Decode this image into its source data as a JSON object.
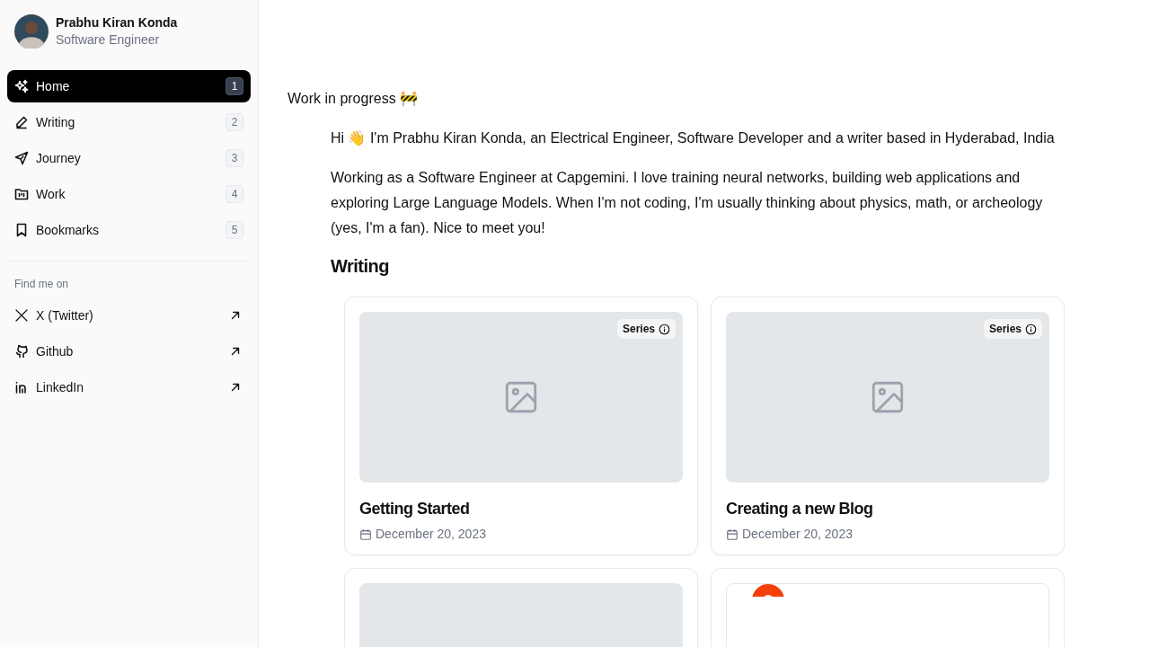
{
  "profile": {
    "name": "Prabhu Kiran Konda",
    "role": "Software Engineer"
  },
  "nav": [
    {
      "label": "Home",
      "shortcut": "1",
      "selected": true
    },
    {
      "label": "Writing",
      "shortcut": "2",
      "selected": false
    },
    {
      "label": "Journey",
      "shortcut": "3",
      "selected": false
    },
    {
      "label": "Work",
      "shortcut": "4",
      "selected": false
    },
    {
      "label": "Bookmarks",
      "shortcut": "5",
      "selected": false
    }
  ],
  "social": {
    "heading": "Find me on",
    "links": [
      {
        "label": "X (Twitter)"
      },
      {
        "label": "Github"
      },
      {
        "label": "LinkedIn"
      }
    ]
  },
  "banner": "Work in progress 🚧",
  "intro": [
    "Hi 👋 I'm Prabhu Kiran Konda, an Electrical Engineer, Software Developer and a writer based in Hyderabad, India",
    "Working as a Software Engineer at Capgemini. I love training neural networks, building web applications and exploring Large Language Models. When I'm not coding, I'm usually thinking about physics, math, or archeology (yes, I'm a fan). Nice to meet you!"
  ],
  "writing": {
    "heading": "Writing",
    "posts": [
      {
        "title": "Getting Started",
        "date": "December 20, 2023",
        "tag": "Series",
        "kind": "placeholder"
      },
      {
        "title": "Creating a new Blog",
        "date": "December 20, 2023",
        "tag": "Series",
        "kind": "placeholder"
      },
      {
        "kind": "plain"
      },
      {
        "kind": "logo"
      }
    ]
  }
}
